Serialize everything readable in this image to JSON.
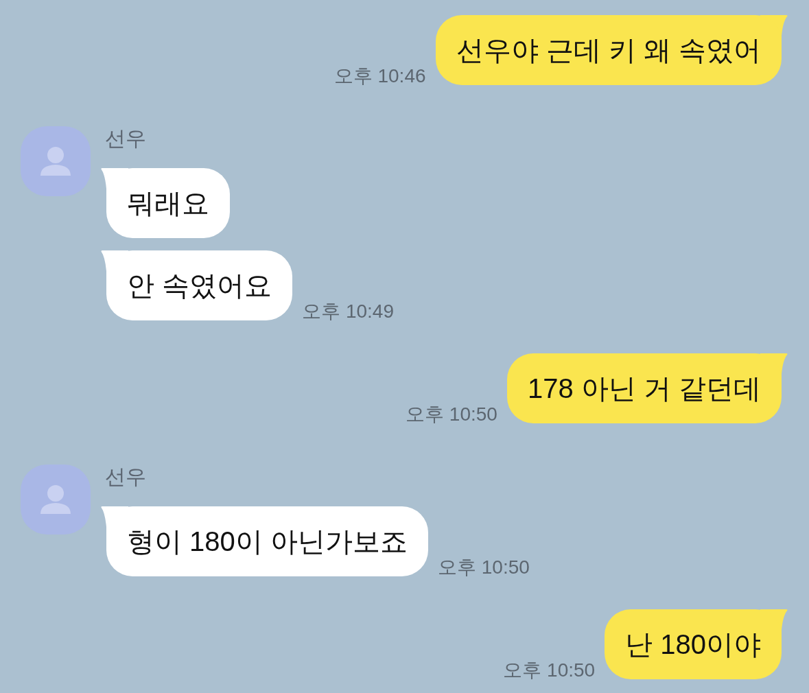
{
  "messages": [
    {
      "kind": "sent",
      "bubbles": [
        {
          "text": "선우야 근데 키 왜 속였어",
          "time": "오후 10:46"
        }
      ]
    },
    {
      "kind": "received",
      "sender": "선우",
      "bubbles": [
        {
          "text": "뭐래요"
        },
        {
          "text": "안 속였어요",
          "time": "오후 10:49"
        }
      ]
    },
    {
      "kind": "sent",
      "bubbles": [
        {
          "text": "178 아닌 거 같던데",
          "time": "오후 10:50"
        }
      ]
    },
    {
      "kind": "received",
      "sender": "선우",
      "bubbles": [
        {
          "text": "형이 180이 아닌가보죠",
          "time": "오후 10:50"
        }
      ]
    },
    {
      "kind": "sent",
      "bubbles": [
        {
          "text": "난 180이야",
          "time": "오후 10:50"
        }
      ]
    }
  ]
}
